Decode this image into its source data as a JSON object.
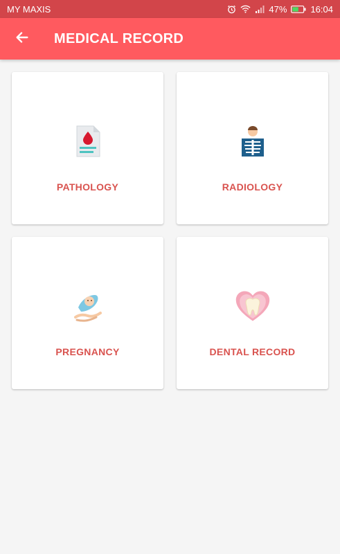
{
  "status_bar": {
    "carrier": "MY MAXIS",
    "battery_percent": "47%",
    "time": "16:04",
    "icons": [
      "alarm-icon",
      "wifi-icon",
      "signal-icon",
      "battery-icon"
    ]
  },
  "app_bar": {
    "title": "MEDICAL RECORD",
    "back_icon": "arrow-left-icon",
    "color": "#ff5a5f"
  },
  "cards": [
    {
      "label": "PATHOLOGY",
      "icon": "blood-report-icon"
    },
    {
      "label": "RADIOLOGY",
      "icon": "xray-icon"
    },
    {
      "label": "PREGNANCY",
      "icon": "baby-hand-icon"
    },
    {
      "label": "DENTAL RECORD",
      "icon": "tooth-heart-icon"
    }
  ],
  "colors": {
    "status_bar": "#d2454a",
    "accent_text": "#d9534f",
    "background": "#f5f5f5"
  }
}
